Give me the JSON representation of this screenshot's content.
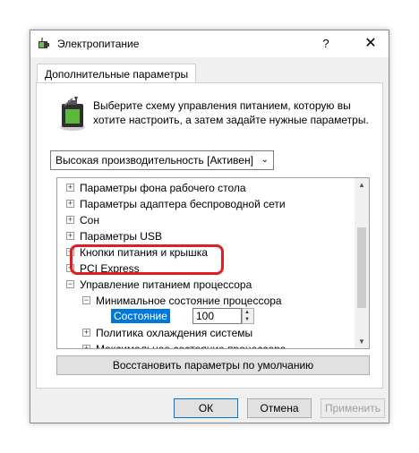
{
  "window": {
    "title": "Электропитание",
    "help": "?",
    "close": "✕"
  },
  "tab": {
    "label": "Дополнительные параметры"
  },
  "description": "Выберите схему управления питанием, которую вы хотите настроить, а затем задайте нужные параметры.",
  "scheme_select": {
    "value": "Высокая производительность [Активен]"
  },
  "tree": {
    "items": [
      {
        "expander": "+",
        "label": "Параметры фона рабочего стола"
      },
      {
        "expander": "+",
        "label": "Параметры адаптера беспроводной сети"
      },
      {
        "expander": "+",
        "label": "Сон"
      },
      {
        "expander": "+",
        "label": "Параметры USB"
      },
      {
        "expander": "+",
        "label": "Кнопки питания и крышка"
      },
      {
        "expander": "+",
        "label": "PCI Express"
      },
      {
        "expander": "−",
        "label": "Управление питанием процессора"
      },
      {
        "expander": "−",
        "label": "Минимальное состояние процессора"
      },
      {
        "expander": "+",
        "label": "Политика охлаждения системы"
      },
      {
        "expander": "+",
        "label": "Максимальное состояние процессора"
      }
    ],
    "state_label": "Состояние (%):",
    "state_value": "100"
  },
  "restore_button": "Восстановить параметры по умолчанию",
  "buttons": {
    "ok": "ОК",
    "cancel": "Отмена",
    "apply": "Применить"
  },
  "colors": {
    "selection": "#0078d7",
    "highlight": "#e02020"
  }
}
